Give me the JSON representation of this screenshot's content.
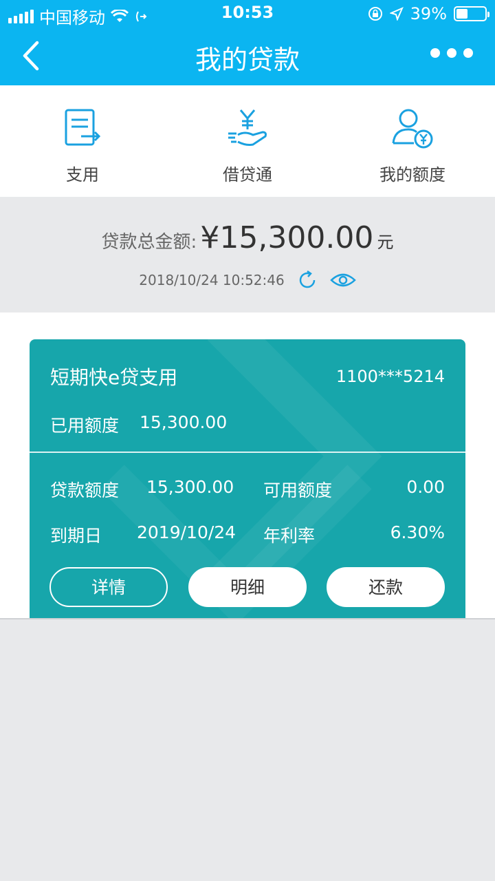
{
  "status_bar": {
    "carrier": "中国移动",
    "time": "10:53",
    "battery": "39%",
    "battery_level": 0.39
  },
  "header": {
    "title": "我的贷款"
  },
  "quick_menu": [
    {
      "label": "支用",
      "icon": "document-arrow-icon"
    },
    {
      "label": "借贷通",
      "icon": "hand-yuan-icon"
    },
    {
      "label": "我的额度",
      "icon": "user-yuan-icon"
    }
  ],
  "summary": {
    "label": "贷款总金额:",
    "amount": "¥15,300.00",
    "unit": "元",
    "timestamp": "2018/10/24 10:52:46"
  },
  "loan_card": {
    "name": "短期快e贷支用",
    "account": "1100***5214",
    "used_label": "已用额度",
    "used_value": "15,300.00",
    "limit_label": "贷款额度",
    "limit_value": "15,300.00",
    "available_label": "可用额度",
    "available_value": "0.00",
    "due_label": "到期日",
    "due_value": "2019/10/24",
    "rate_label": "年利率",
    "rate_value": "6.30%",
    "buttons": {
      "details": "详情",
      "statement": "明细",
      "repay": "还款"
    }
  },
  "colors": {
    "header": "#0bb5f1",
    "card": "#17a6ab",
    "icon": "#1aa1e0"
  }
}
